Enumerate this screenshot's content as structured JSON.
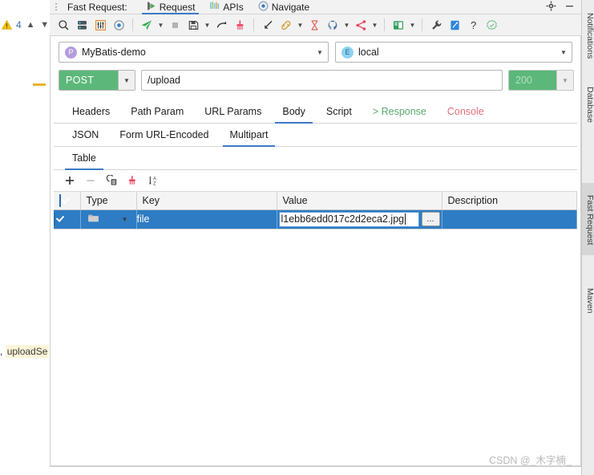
{
  "window": {
    "grip_icon": "vertical-dots-icon",
    "plugin_title": "Fast Request:",
    "tabs": [
      {
        "label": "Request",
        "icon": "request-icon",
        "active": true
      },
      {
        "label": "APIs",
        "icon": "apis-bars-icon",
        "active": false
      },
      {
        "label": "Navigate",
        "icon": "navigate-target-icon",
        "active": false
      }
    ],
    "settings_icon": "gear-icon",
    "minimize_icon": "minimize-icon"
  },
  "editor_gutter": {
    "warning_icon": "warning-triangle-icon",
    "warning_count": "4",
    "prev_icon": "chevron-up-icon",
    "next_icon": "chevron-down-icon",
    "code_fragment_comma": ",",
    "code_fragment_identifier": "uploadSe"
  },
  "toolbar": {
    "buttons": [
      {
        "name": "search-icon",
        "label": "Search"
      },
      {
        "name": "collections-icon",
        "label": "Collections"
      },
      {
        "name": "sliders-icon",
        "label": "Parameters"
      },
      {
        "name": "target-icon",
        "label": "Locate"
      },
      {
        "name": "send-icon",
        "label": "Send"
      },
      {
        "name": "stop-icon",
        "label": "Stop"
      },
      {
        "name": "save-icon",
        "label": "Save"
      },
      {
        "name": "redo-icon",
        "label": "Resend"
      },
      {
        "name": "clean-brush-icon",
        "label": "Clear"
      },
      {
        "name": "import-icon",
        "label": "Import"
      },
      {
        "name": "link-icon",
        "label": "Link"
      },
      {
        "name": "hourglass-icon",
        "label": "History"
      },
      {
        "name": "github-icon",
        "label": "GitHub"
      },
      {
        "name": "share-icon",
        "label": "Share"
      },
      {
        "name": "book-icon",
        "label": "Docs"
      },
      {
        "name": "wrench-icon",
        "label": "Settings"
      },
      {
        "name": "blue-square-icon",
        "label": "Postman"
      },
      {
        "name": "help-icon",
        "label": "Help"
      },
      {
        "name": "badge-icon",
        "label": "Support"
      }
    ]
  },
  "request": {
    "project": {
      "badge": "P",
      "name": "MyBatis-demo",
      "caret_icon": "chevron-down-icon"
    },
    "environment": {
      "badge": "E",
      "name": "local",
      "caret_icon": "chevron-down-icon"
    },
    "method": "POST",
    "method_caret_icon": "chevron-down-icon",
    "url": "/upload",
    "status_code": "200",
    "status_caret_icon": "chevron-down-icon"
  },
  "main_tabs": [
    {
      "label": "Headers",
      "active": false,
      "style": "normal"
    },
    {
      "label": "Path Param",
      "active": false,
      "style": "normal"
    },
    {
      "label": "URL Params",
      "active": false,
      "style": "normal"
    },
    {
      "label": "Body",
      "active": true,
      "style": "normal"
    },
    {
      "label": "Script",
      "active": false,
      "style": "normal"
    },
    {
      "label": "> Response",
      "active": false,
      "style": "green"
    },
    {
      "label": "Console",
      "active": false,
      "style": "red"
    }
  ],
  "body_tabs": [
    {
      "label": "JSON",
      "active": false
    },
    {
      "label": "Form URL-Encoded",
      "active": false
    },
    {
      "label": "Multipart",
      "active": true
    }
  ],
  "view_tabs": [
    {
      "label": "Table",
      "active": true
    }
  ],
  "table_toolbar": [
    {
      "name": "add-row-icon",
      "label": "Add"
    },
    {
      "name": "remove-row-icon",
      "label": "Remove"
    },
    {
      "name": "copy-row-icon",
      "label": "Copy"
    },
    {
      "name": "clear-table-icon",
      "label": "Clear"
    },
    {
      "name": "sort-az-icon",
      "label": "Sort"
    }
  ],
  "table": {
    "columns": [
      "",
      "Type",
      "Key",
      "Value",
      "Description"
    ],
    "header_checkbox_checked": true,
    "rows": [
      {
        "checked": true,
        "type_icon": "folder-icon",
        "type_caret_icon": "chevron-down-icon",
        "key": "file",
        "value": "l1ebb6edd017c2d2eca2.jpg",
        "value_browse_label": "...",
        "description": "",
        "selected": true
      }
    ]
  },
  "tool_windows": [
    {
      "label": "Notifications",
      "selected": false
    },
    {
      "label": "Database",
      "selected": false
    },
    {
      "label": "Fast Request",
      "selected": true
    },
    {
      "label": "Maven",
      "selected": false
    }
  ],
  "watermark": "CSDN @_木字楠_",
  "colors": {
    "accent_blue": "#3d7ac5",
    "method_green": "#5cb87a",
    "selection_blue": "#2d7cc4",
    "response_green": "#5aa86e",
    "console_red": "#e2707f"
  }
}
